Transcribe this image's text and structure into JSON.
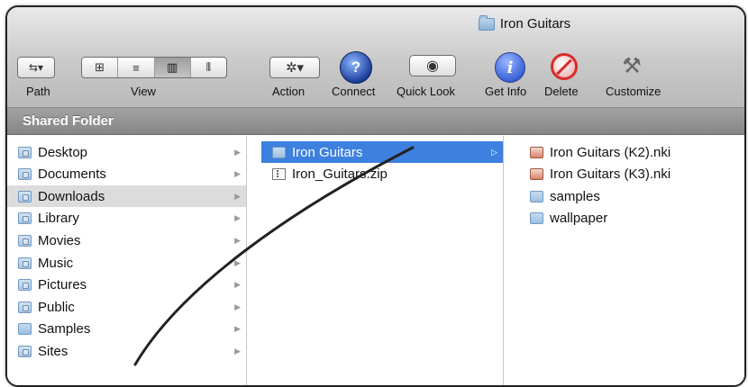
{
  "window": {
    "title": "Iron Guitars"
  },
  "toolbar": {
    "path_label": "Path",
    "view_label": "View",
    "action_label": "Action",
    "connect_label": "Connect",
    "quicklook_label": "Quick Look",
    "getinfo_label": "Get Info",
    "delete_label": "Delete",
    "customize_label": "Customize",
    "view_modes": [
      "icon-view",
      "list-view",
      "column-view",
      "coverflow-view"
    ],
    "selected_view": "column-view"
  },
  "path_bar": {
    "label": "Shared Folder"
  },
  "sidebar": {
    "items": [
      {
        "label": "Desktop",
        "icon": "desktop-folder-icon"
      },
      {
        "label": "Documents",
        "icon": "documents-folder-icon"
      },
      {
        "label": "Downloads",
        "icon": "downloads-folder-icon",
        "selected": true
      },
      {
        "label": "Library",
        "icon": "library-folder-icon"
      },
      {
        "label": "Movies",
        "icon": "movies-folder-icon"
      },
      {
        "label": "Music",
        "icon": "music-folder-icon"
      },
      {
        "label": "Pictures",
        "icon": "pictures-folder-icon"
      },
      {
        "label": "Public",
        "icon": "public-folder-icon"
      },
      {
        "label": "Samples",
        "icon": "folder-icon"
      },
      {
        "label": "Sites",
        "icon": "sites-folder-icon"
      }
    ]
  },
  "column2": {
    "items": [
      {
        "label": "Iron Guitars",
        "icon": "folder-icon",
        "selected": true
      },
      {
        "label": "Iron_Guitars.zip",
        "icon": "zip-file-icon"
      }
    ]
  },
  "column3": {
    "items": [
      {
        "label": "Iron Guitars (K2).nki",
        "icon": "nki-file-icon"
      },
      {
        "label": "Iron Guitars (K3).nki",
        "icon": "nki-file-icon"
      },
      {
        "label": "samples",
        "icon": "folder-icon"
      },
      {
        "label": "wallpaper",
        "icon": "folder-icon"
      }
    ]
  },
  "colors": {
    "selection_blue": "#3d80df",
    "selection_gray": "#dcdcdc",
    "pathbar_gray": "#8f8f8f"
  }
}
